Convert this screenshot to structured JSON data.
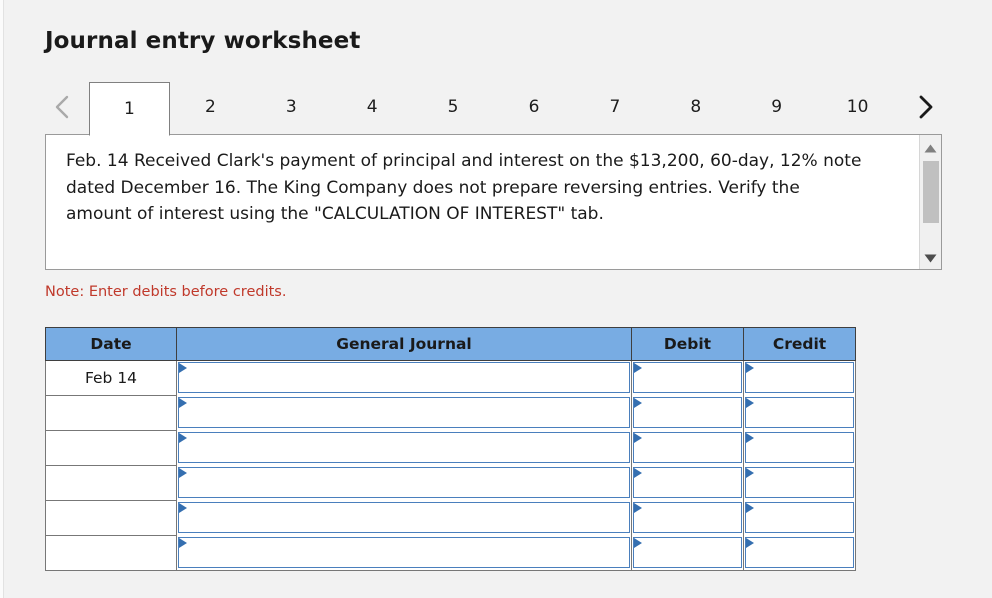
{
  "page": {
    "title": "Journal entry worksheet",
    "background_color": "#f2f2f2"
  },
  "tabs": {
    "prev_icon": "chevron-left-icon",
    "next_icon": "chevron-right-icon",
    "prev_enabled": false,
    "next_enabled": true,
    "active_index": 0,
    "items": [
      {
        "label": "1"
      },
      {
        "label": "2"
      },
      {
        "label": "3"
      },
      {
        "label": "4"
      },
      {
        "label": "5"
      },
      {
        "label": "6"
      },
      {
        "label": "7"
      },
      {
        "label": "8"
      },
      {
        "label": "9"
      },
      {
        "label": "10"
      }
    ]
  },
  "instruction": {
    "text": "Feb. 14 Received Clark's payment of principal and interest on the $13,200, 60-day, 12% note dated December 16. The King Company does not prepare reversing entries. Verify the amount of interest using the \"CALCULATION OF INTEREST\" tab.",
    "scrollbar": {
      "up_icon": "triangle-up-icon",
      "down_icon": "triangle-down-icon",
      "thumb_color": "#c0c0c0",
      "track_color": "#f0f0f0"
    }
  },
  "note": {
    "text": "Note: Enter debits before credits.",
    "color": "#c0392b"
  },
  "journal": {
    "header_color": "#78ace3",
    "columns": [
      {
        "key": "date",
        "label": "Date"
      },
      {
        "key": "gj",
        "label": "General Journal"
      },
      {
        "key": "debit",
        "label": "Debit"
      },
      {
        "key": "credit",
        "label": "Credit"
      }
    ],
    "rows": [
      {
        "date": "Feb 14",
        "gj": "",
        "debit": "",
        "credit": ""
      },
      {
        "date": "",
        "gj": "",
        "debit": "",
        "credit": ""
      },
      {
        "date": "",
        "gj": "",
        "debit": "",
        "credit": ""
      },
      {
        "date": "",
        "gj": "",
        "debit": "",
        "credit": ""
      },
      {
        "date": "",
        "gj": "",
        "debit": "",
        "credit": ""
      },
      {
        "date": "",
        "gj": "",
        "debit": "",
        "credit": ""
      }
    ]
  }
}
